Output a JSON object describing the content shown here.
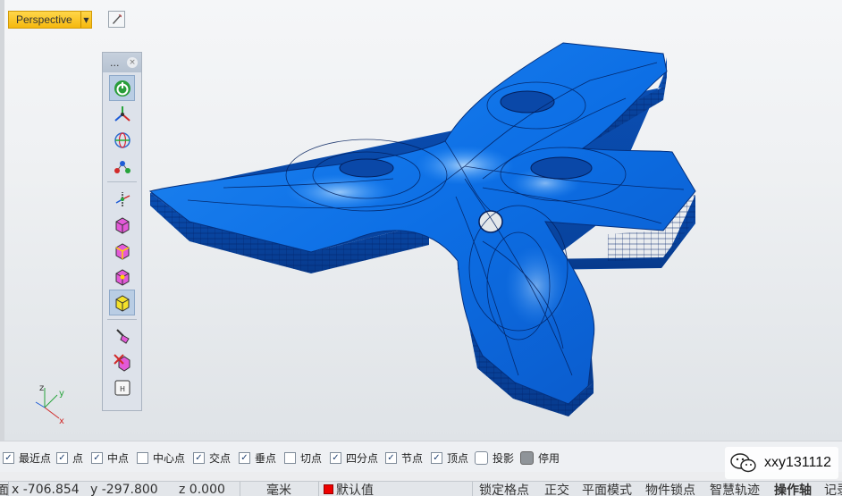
{
  "viewport": {
    "name": "Perspective",
    "axis": {
      "x": "x",
      "y": "y",
      "z": "z"
    }
  },
  "toolbar": {
    "title": "...",
    "close_glyph": "×",
    "buttons": [
      {
        "icon": "power-icon",
        "tooltip": ""
      },
      {
        "icon": "gumball-axes-icon"
      },
      {
        "icon": "globe-grid-icon"
      },
      {
        "icon": "control-point-icon"
      },
      {
        "icon": "axis-move-icon"
      },
      {
        "icon": "cube-face-icon"
      },
      {
        "icon": "cube-edge-icon"
      },
      {
        "icon": "cube-vertex-icon"
      },
      {
        "icon": "cube-yellow-icon"
      },
      {
        "icon": "brush-icon"
      },
      {
        "icon": "delete-cube-icon"
      },
      {
        "icon": "history-icon"
      }
    ]
  },
  "osnap": {
    "items": [
      {
        "label": "最近点",
        "checked": true
      },
      {
        "label": "点",
        "checked": true
      },
      {
        "label": "中点",
        "checked": true
      },
      {
        "label": "中心点",
        "checked": false
      },
      {
        "label": "交点",
        "checked": true
      },
      {
        "label": "垂点",
        "checked": true
      },
      {
        "label": "切点",
        "checked": false
      },
      {
        "label": "四分点",
        "checked": true
      },
      {
        "label": "节点",
        "checked": true
      },
      {
        "label": "顶点",
        "checked": true
      },
      {
        "label": "投影",
        "checked": false
      },
      {
        "label": "停用",
        "checked": false
      }
    ],
    "check_glyph": "✓"
  },
  "watermark": {
    "text": "xxy131112"
  },
  "status": {
    "left_cut": "面",
    "x": "x -706.854",
    "y": "y -297.800",
    "z": "z 0.000",
    "unit": "毫米",
    "layer": "默认值",
    "layer_color": "#e00000",
    "toggles": [
      "锁定格点",
      "正交",
      "平面模式",
      "物件锁点",
      "智慧轨迹",
      "操作轴",
      "记录"
    ]
  }
}
